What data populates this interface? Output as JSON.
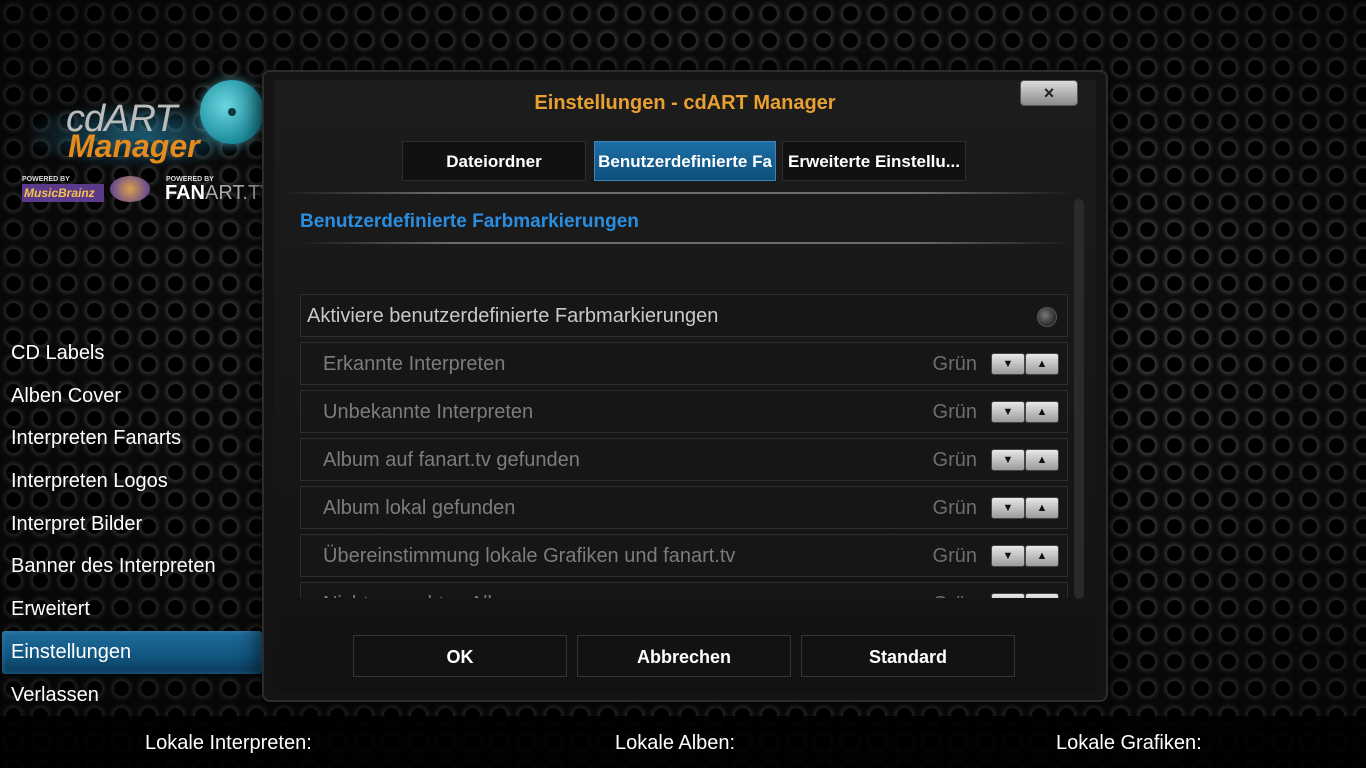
{
  "logo": {
    "text_main": "cdART",
    "text_sub": "Manager",
    "powered_by_1": "POWERED BY",
    "musicbrainz": "MusicBrainz",
    "powered_by_2": "POWERED BY",
    "fanart_a": "FAN",
    "fanart_b": "ART.TV"
  },
  "sidebar": {
    "items": [
      {
        "label": "CD Labels"
      },
      {
        "label": "Alben Cover"
      },
      {
        "label": "Interpreten Fanarts"
      },
      {
        "label": "Interpreten Logos"
      },
      {
        "label": "Interpret Bilder"
      },
      {
        "label": "Banner des Interpreten"
      },
      {
        "label": "Erweitert"
      },
      {
        "label": "Einstellungen"
      },
      {
        "label": "Verlassen"
      }
    ],
    "active_index": 7
  },
  "footer": {
    "local_artists": "Lokale Interpreten:",
    "local_albums": "Lokale Alben:",
    "local_artwork": "Lokale Grafiken:"
  },
  "dialog": {
    "title": "Einstellungen - cdART Manager",
    "close_label": "×",
    "tabs": [
      {
        "label": "Dateiordner"
      },
      {
        "label": "Benutzerdefinierte Fa"
      },
      {
        "label": "Erweiterte Einstellu..."
      }
    ],
    "active_tab": 1,
    "section_title": "Benutzerdefinierte Farbmarkierungen",
    "rows": [
      {
        "label": "Aktiviere benutzerdefinierte Farbmarkierungen",
        "type": "toggle",
        "value": false
      },
      {
        "label": "Erkannte Interpreten",
        "value": "Grün"
      },
      {
        "label": "Unbekannte Interpreten",
        "value": "Grün"
      },
      {
        "label": "Album auf fanart.tv gefunden",
        "value": "Grün"
      },
      {
        "label": "Album lokal gefunden",
        "value": "Grün"
      },
      {
        "label": "Übereinstimmung lokale Grafiken und fanart.tv",
        "value": "Grün"
      },
      {
        "label": "Nicht gesuchtes Album",
        "value": "Grün"
      }
    ],
    "buttons": {
      "ok": "OK",
      "cancel": "Abbrechen",
      "default": "Standard"
    }
  },
  "colors": {
    "accent_blue": "#2a8ee0",
    "title_orange": "#e8a030",
    "logo_orange": "#e58a1c"
  }
}
